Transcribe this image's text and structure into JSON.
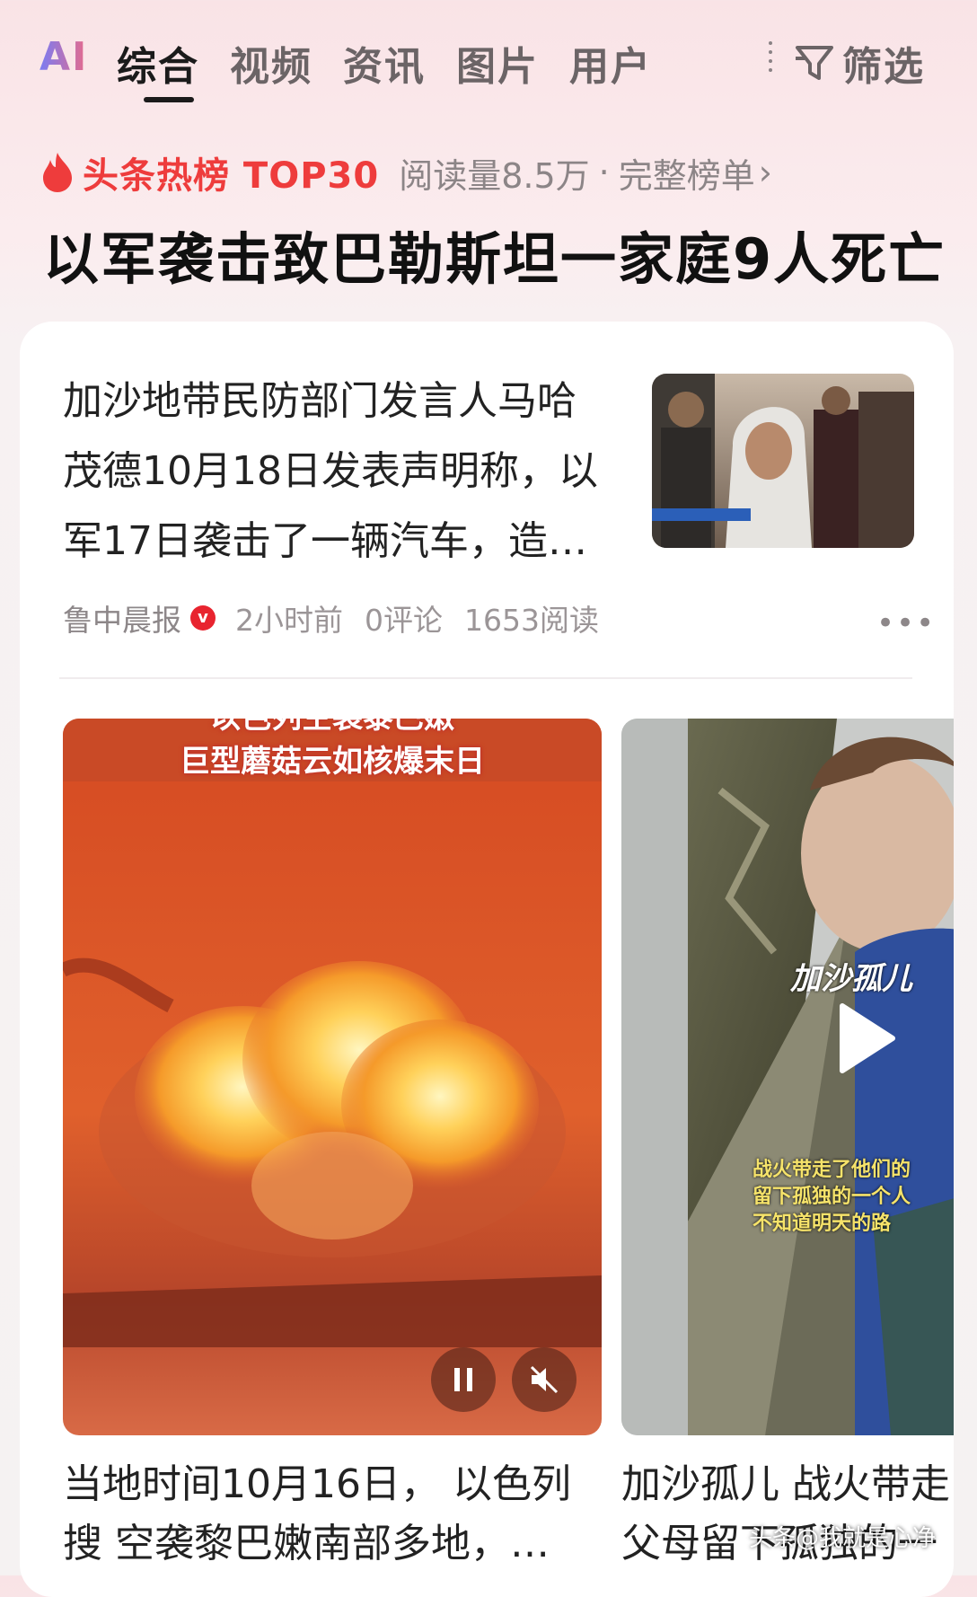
{
  "tabs": {
    "ai": "AI",
    "items": [
      "综合",
      "视频",
      "资讯",
      "图片",
      "用户"
    ],
    "active": "综合",
    "filter_label": "筛选"
  },
  "hot": {
    "label": "头条热榜 TOP30",
    "reads": "阅读量8.5万",
    "separator": "·",
    "full_list": "完整榜单",
    "headline": "以军袭击致巴勒斯坦一家庭9人死亡"
  },
  "article": {
    "lines": [
      "加沙地带民防部门发言人马哈",
      "茂德10月18日发表声明称，以",
      "军17日袭击了一辆汽车，造…"
    ],
    "source": "鲁中晨报",
    "verified_badge": "v",
    "time": "2小时前",
    "comments": "0评论",
    "reads": "1653阅读"
  },
  "video1": {
    "overlay_line1": "以色列空袭黎巴嫩",
    "overlay_line2": "巨型蘑菇云如核爆末日",
    "caption_lines": [
      "当地时间10月16日， 以色列",
      "搜 空袭黎巴嫩南部多地，…"
    ]
  },
  "video2": {
    "overlay_title": "加沙孤儿",
    "overlay_sub1": "战火带走了他们的",
    "overlay_sub2": "留下孤独的一个人",
    "overlay_sub3": "不知道明天的路",
    "caption_lines": [
      "加沙孤儿 战火带走",
      "父母留下孤独的一"
    ]
  },
  "watermark": "头条@我就是心净",
  "colors": {
    "accent_red": "#ee3c3c",
    "verified_red": "#e8242f"
  }
}
